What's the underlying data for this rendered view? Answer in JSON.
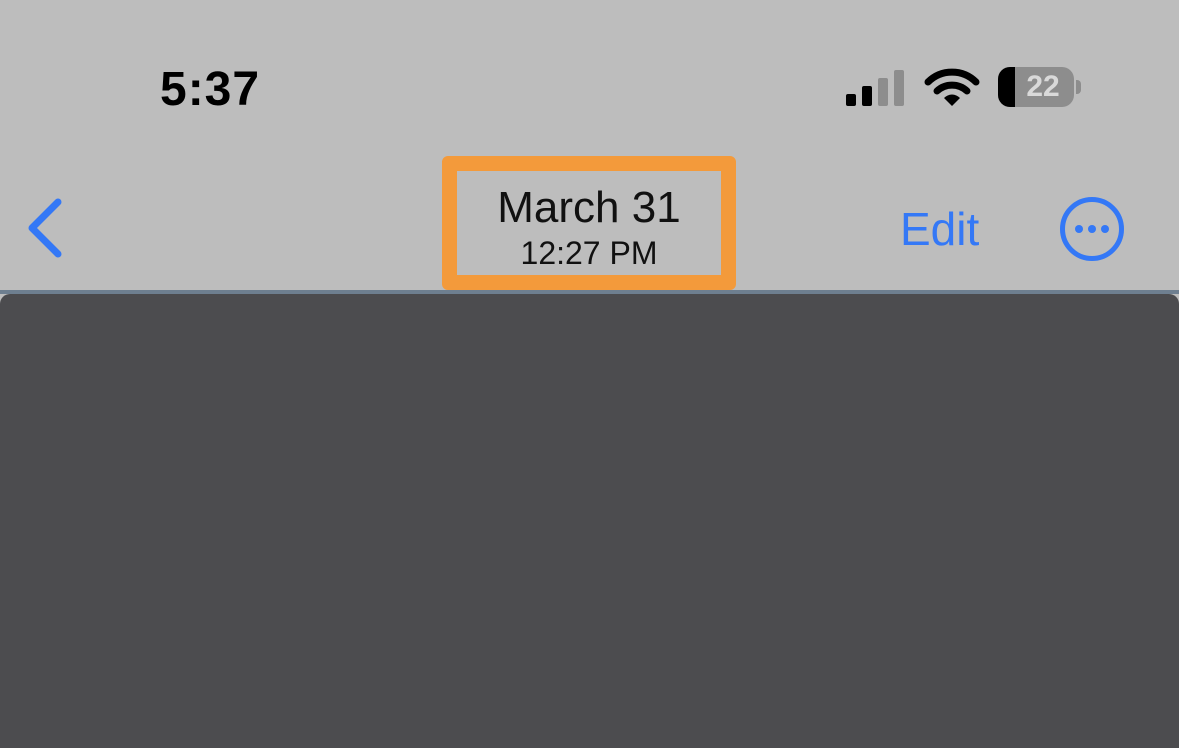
{
  "status_bar": {
    "time": "5:37",
    "battery_level": "22",
    "battery_fill_fraction": 0.22,
    "icons": [
      "signal-icon",
      "wifi-icon",
      "battery-icon"
    ]
  },
  "nav_bar": {
    "back_icon": "chevron-left-icon",
    "title_date": "March 31",
    "title_time": "12:27 PM",
    "edit_label": "Edit",
    "more_icon": "ellipsis-circle-icon",
    "accent_color": "#3478f6",
    "highlight_color": "#f39a3b"
  },
  "content": {
    "background_color": "#4c4c4f"
  }
}
